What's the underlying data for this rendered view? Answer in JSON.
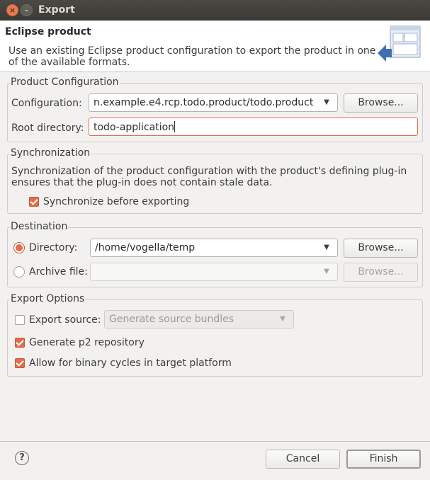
{
  "window": {
    "title": "Export"
  },
  "header": {
    "title": "Eclipse product",
    "description": "Use an existing Eclipse product configuration to export the product in one of the available formats."
  },
  "product_configuration": {
    "group_label": "Product Configuration",
    "configuration_label": "Configuration:",
    "configuration_value": "n.example.e4.rcp.todo.product/todo.product",
    "browse_label": "Browse...",
    "root_directory_label": "Root directory:",
    "root_directory_value": "todo-application"
  },
  "synchronization": {
    "group_label": "Synchronization",
    "description": "Synchronization of the product configuration with the product's defining plug-in ensures that the plug-in does not contain stale data.",
    "checkbox_label": "Synchronize before exporting",
    "checked": true
  },
  "destination": {
    "group_label": "Destination",
    "directory_label": "Directory:",
    "directory_value": "/home/vogella/temp",
    "directory_selected": true,
    "browse_label": "Browse...",
    "archive_label": "Archive file:",
    "archive_value": "",
    "archive_browse_label": "Browse..."
  },
  "export_options": {
    "group_label": "Export Options",
    "export_source_label": "Export source:",
    "export_source_checked": false,
    "export_source_combo": "Generate source bundles",
    "p2_label": "Generate p2 repository",
    "p2_checked": true,
    "binary_cycles_label": "Allow for binary cycles in target platform",
    "binary_cycles_checked": true
  },
  "footer": {
    "help_glyph": "?",
    "cancel_label": "Cancel",
    "finish_label": "Finish"
  },
  "colors": {
    "accent": "#e36d4a",
    "titlebar": "#3b3a36",
    "background": "#f2f1f0"
  }
}
